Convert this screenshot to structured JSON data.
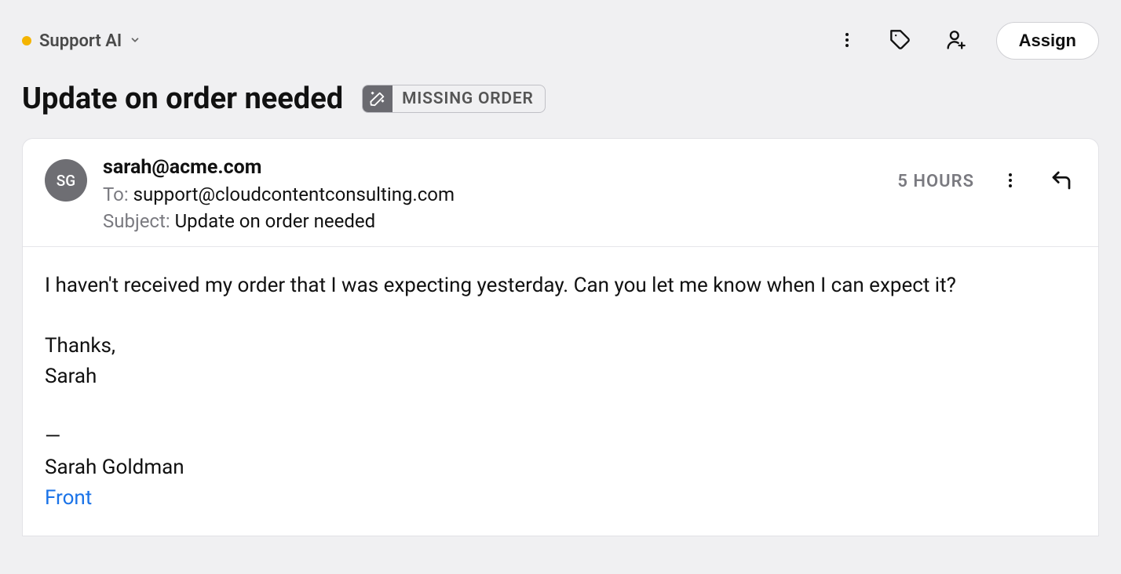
{
  "header": {
    "channel_name": "Support AI",
    "assign_label": "Assign"
  },
  "conversation": {
    "title": "Update on order needed",
    "tag_label": "MISSING ORDER"
  },
  "message": {
    "avatar_initials": "SG",
    "from": "sarah@acme.com",
    "to_label": "To:",
    "to_value": "support@cloudcontentconsulting.com",
    "subject_label": "Subject:",
    "subject_value": "Update on order needed",
    "timestamp": "5 HOURS",
    "body_line1": "I haven't received my order that I was expecting yesterday. Can you let me know when I can expect it?",
    "body_thanks": "Thanks,",
    "body_name": "Sarah",
    "sig_dash": "—",
    "sig_name": "Sarah Goldman",
    "sig_link": "Front"
  }
}
